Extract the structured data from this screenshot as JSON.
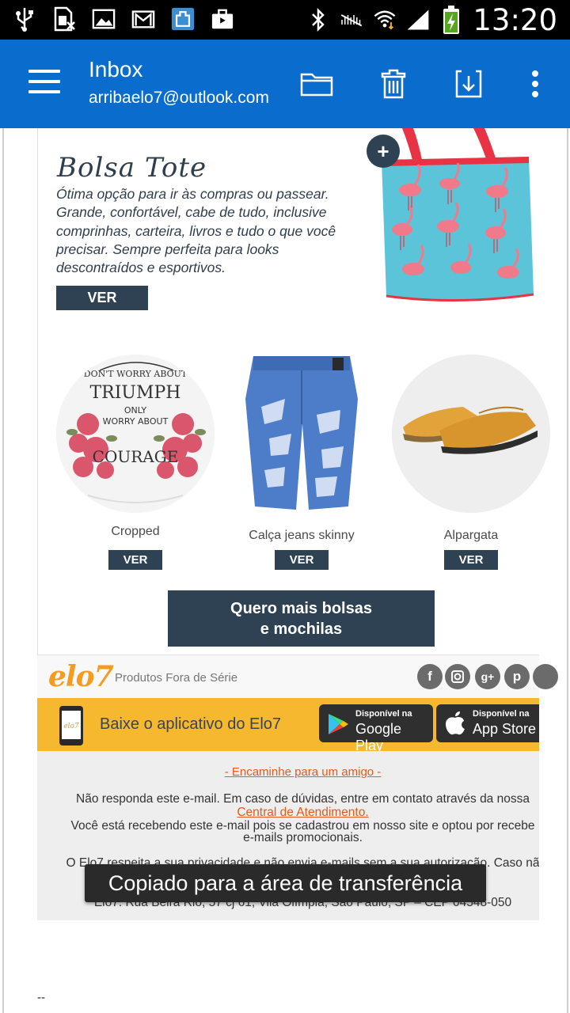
{
  "status_bar": {
    "time": "13:20",
    "icons": [
      "usb-icon",
      "sim-icon",
      "image-icon",
      "gmail-icon",
      "app-icon",
      "bag-icon",
      "bluetooth-icon",
      "mute-icon",
      "wifi-icon",
      "signal-icon",
      "battery-icon"
    ]
  },
  "appbar": {
    "title": "Inbox",
    "account": "arribaelo7@outlook.com",
    "actions": [
      "folder-icon",
      "delete-icon",
      "archive-icon",
      "more-vertical-icon"
    ]
  },
  "email": {
    "featured": {
      "title": "Bolsa Tote",
      "description": "Ótima opção para ir às compras ou passear. Grande, confortável, cabe de tudo, inclusive comprinhas, carteira, livros e tudo o que você precisar. Sempre perfeita para looks descontraídos e esportivos.",
      "button": "VER",
      "plus": "+"
    },
    "products": [
      {
        "name": "Cropped",
        "button": "VER"
      },
      {
        "name": "Calça jeans skinny",
        "button": "VER"
      },
      {
        "name": "Alpargata",
        "button": "VER"
      }
    ],
    "shirt_text": [
      "DON'T WORRY ABOUT",
      "TRIUMPH",
      "ONLY",
      "WORRY ABOUT",
      "COURAGE"
    ],
    "more_button": {
      "line1": "Quero mais bolsas",
      "line2": "e mochilas"
    },
    "brand": {
      "logo": "elo7",
      "tagline": "Produtos Fora de Série"
    },
    "social_icons": [
      "facebook-icon",
      "instagram-icon",
      "google-plus-icon",
      "pinterest-icon",
      "more-social-icon"
    ],
    "app_promo": {
      "text": "Baixe o aplicativo do Elo7",
      "phone_logo": "elo7",
      "google": {
        "small": "Disponível na",
        "big": "Google Play"
      },
      "apple": {
        "small": "Disponível na",
        "big": "App Store"
      }
    },
    "forward_link": "- Encaminhe para um amigo -",
    "legal": {
      "l1": "Não responda este e-mail. Em caso de dúvidas, entre em contato através da nossa",
      "l1_link": "Central de Atendimento.",
      "l2a": "Você está recebendo este e-mail pois se cadastrou em nosso site e optou por recebe",
      "l2b": "e-mails promocionais.",
      "l3": "O Elo7 respeita a sua privacidade e não envia e-mails sem a sua autorização. Caso nã",
      "l4": "Elo7: Rua Beira Rio, 57 cj 61, Vila Olímpia, São Paulo, SP – CEP 04548-050"
    },
    "signature": "--"
  },
  "toast": "Copiado para a área de transferência",
  "colors": {
    "appbar": "#0a6ccd",
    "dark_button": "#2e4254",
    "elo7_orange": "#f39c1f",
    "app_banner": "#f5b82e",
    "link_orange": "#e45a1d"
  }
}
